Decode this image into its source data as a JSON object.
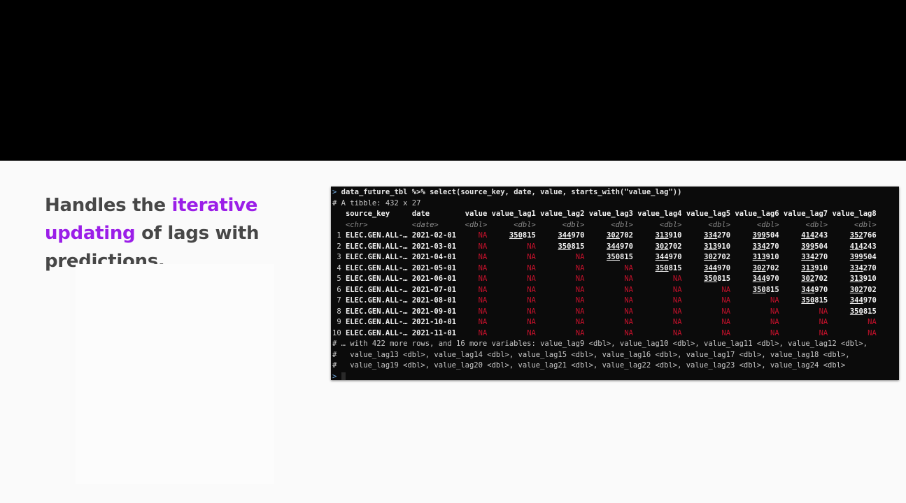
{
  "slide": {
    "text_before": "Handles the ",
    "text_accent": "iterative updating",
    "text_after": " of lags with predictions.",
    "accent_color": "#9b1ee8"
  },
  "console": {
    "prompt_char": ">",
    "command": "data_future_tbl %>% select(source_key, date, value, starts_with(\"value_lag\"))",
    "tibble_info": "# A tibble: 432 x 27",
    "headers": [
      "source_key",
      "date",
      "value",
      "value_lag1",
      "value_lag2",
      "value_lag3",
      "value_lag4",
      "value_lag5",
      "value_lag6",
      "value_lag7",
      "value_lag8"
    ],
    "types": [
      "<chr>",
      "<date>",
      "<dbl>",
      "<dbl>",
      "<dbl>",
      "<dbl>",
      "<dbl>",
      "<dbl>",
      "<dbl>",
      "<dbl>",
      "<dbl>"
    ],
    "na_text": "NA",
    "rows": [
      {
        "n": "1",
        "key": "ELEC.GEN.ALL-…",
        "date": "2021-02-01",
        "vals": [
          "NA",
          "350815",
          "344970",
          "302702",
          "313910",
          "334270",
          "399504",
          "414243",
          "352766"
        ]
      },
      {
        "n": "2",
        "key": "ELEC.GEN.ALL-…",
        "date": "2021-03-01",
        "vals": [
          "NA",
          "NA",
          "350815",
          "344970",
          "302702",
          "313910",
          "334270",
          "399504",
          "414243"
        ]
      },
      {
        "n": "3",
        "key": "ELEC.GEN.ALL-…",
        "date": "2021-04-01",
        "vals": [
          "NA",
          "NA",
          "NA",
          "350815",
          "344970",
          "302702",
          "313910",
          "334270",
          "399504"
        ]
      },
      {
        "n": "4",
        "key": "ELEC.GEN.ALL-…",
        "date": "2021-05-01",
        "vals": [
          "NA",
          "NA",
          "NA",
          "NA",
          "350815",
          "344970",
          "302702",
          "313910",
          "334270"
        ]
      },
      {
        "n": "5",
        "key": "ELEC.GEN.ALL-…",
        "date": "2021-06-01",
        "vals": [
          "NA",
          "NA",
          "NA",
          "NA",
          "NA",
          "350815",
          "344970",
          "302702",
          "313910"
        ]
      },
      {
        "n": "6",
        "key": "ELEC.GEN.ALL-…",
        "date": "2021-07-01",
        "vals": [
          "NA",
          "NA",
          "NA",
          "NA",
          "NA",
          "NA",
          "350815",
          "344970",
          "302702"
        ]
      },
      {
        "n": "7",
        "key": "ELEC.GEN.ALL-…",
        "date": "2021-08-01",
        "vals": [
          "NA",
          "NA",
          "NA",
          "NA",
          "NA",
          "NA",
          "NA",
          "350815",
          "344970"
        ]
      },
      {
        "n": "8",
        "key": "ELEC.GEN.ALL-…",
        "date": "2021-09-01",
        "vals": [
          "NA",
          "NA",
          "NA",
          "NA",
          "NA",
          "NA",
          "NA",
          "NA",
          "350815"
        ]
      },
      {
        "n": "9",
        "key": "ELEC.GEN.ALL-…",
        "date": "2021-10-01",
        "vals": [
          "NA",
          "NA",
          "NA",
          "NA",
          "NA",
          "NA",
          "NA",
          "NA",
          "NA"
        ]
      },
      {
        "n": "10",
        "key": "ELEC.GEN.ALL-…",
        "date": "2021-11-01",
        "vals": [
          "NA",
          "NA",
          "NA",
          "NA",
          "NA",
          "NA",
          "NA",
          "NA",
          "NA"
        ]
      }
    ],
    "footer": [
      "# … with 422 more rows, and 16 more variables: value_lag9 <dbl>, value_lag10 <dbl>, value_lag11 <dbl>, value_lag12 <dbl>,",
      "#   value_lag13 <dbl>, value_lag14 <dbl>, value_lag15 <dbl>, value_lag16 <dbl>, value_lag17 <dbl>, value_lag18 <dbl>,",
      "#   value_lag19 <dbl>, value_lag20 <dbl>, value_lag21 <dbl>, value_lag22 <dbl>, value_lag23 <dbl>, value_lag24 <dbl>"
    ],
    "colors": {
      "na": "#c4112b",
      "prompt": "#6fa8dc",
      "background": "#0b0b0b"
    }
  }
}
